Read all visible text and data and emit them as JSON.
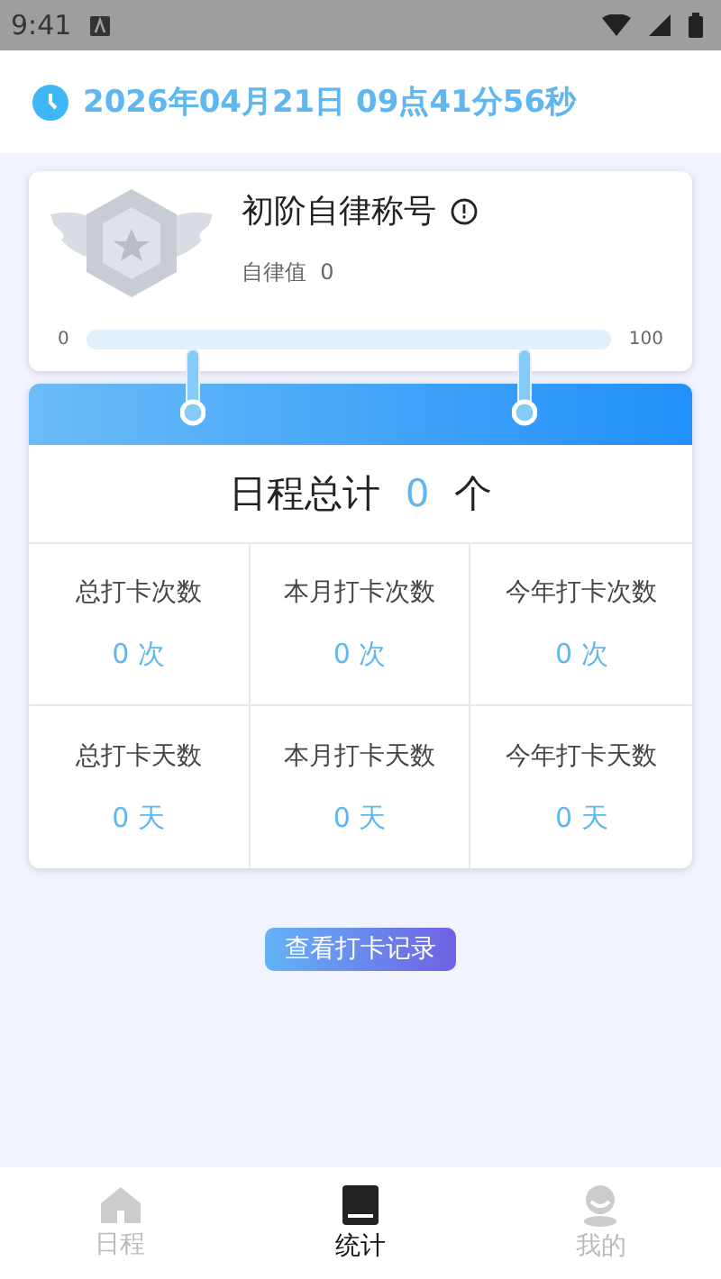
{
  "status_bar": {
    "time": "9:41"
  },
  "header": {
    "datetime": "2026年04月21日 09点41分56秒"
  },
  "title_card": {
    "title": "初阶自律称号",
    "score_label": "自律值",
    "score": "0",
    "progress": {
      "min": "0",
      "max": "100",
      "level": 0
    }
  },
  "summary": {
    "label": "日程总计",
    "count": "0",
    "unit": "个"
  },
  "stats": [
    {
      "label": "总打卡次数",
      "value": "0 次"
    },
    {
      "label": "本月打卡次数",
      "value": "0 次"
    },
    {
      "label": "今年打卡次数",
      "value": "0 次"
    },
    {
      "label": "总打卡天数",
      "value": "0 天"
    },
    {
      "label": "本月打卡天数",
      "value": "0 天"
    },
    {
      "label": "今年打卡天数",
      "value": "0 天"
    }
  ],
  "record_button": "查看打卡记录",
  "tab_bar": [
    {
      "label": "日程",
      "kind": "home",
      "selected": false
    },
    {
      "label": "统计",
      "kind": "book",
      "selected": true
    },
    {
      "label": "我的",
      "kind": "user",
      "selected": false
    }
  ]
}
